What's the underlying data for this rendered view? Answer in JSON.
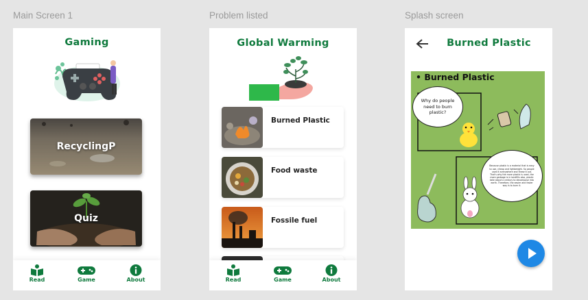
{
  "frames": {
    "main_label": "Main Screen 1",
    "problems_label": "Problem listed",
    "splash_label": "Splash screen"
  },
  "main": {
    "title": "Gaming",
    "cards": [
      {
        "label": "RecyclingP"
      },
      {
        "label": "Quiz"
      }
    ]
  },
  "problems": {
    "title": "Global Warming",
    "items": [
      {
        "label": "Burned Plastic"
      },
      {
        "label": "Food waste"
      },
      {
        "label": "Fossile fuel"
      }
    ]
  },
  "splash": {
    "title": "Burned Plastic",
    "comic": {
      "heading": "• Burned Plastic",
      "bubble1": "Why do people need to burn plastic?",
      "bubble2": "Because plastic is a material that is easy to use, cheap and lightweight. So people used it everywhere and threw it out. That's why the more plastic is used, the more garbage is in landfills also, plastic take about a century to decompose into earth. Therefore, the easier and faster way is to burn it."
    }
  },
  "nav": {
    "read": "Read",
    "game": "Game",
    "about": "About"
  },
  "colors": {
    "brand_green": "#0f7a3d",
    "play_blue": "#1e88e5"
  }
}
